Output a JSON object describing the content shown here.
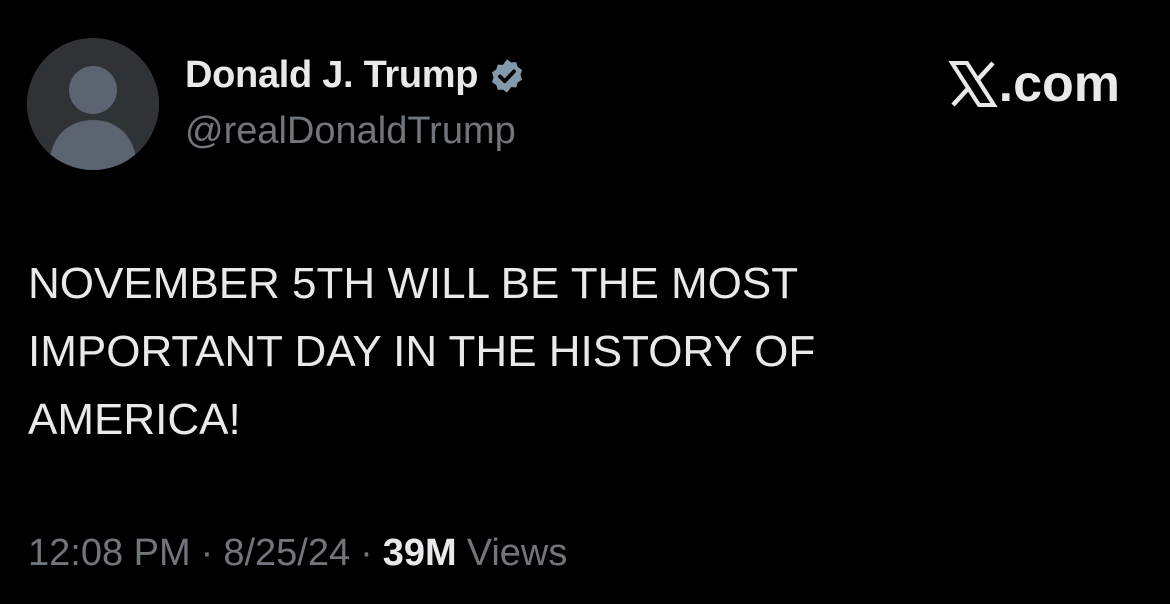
{
  "post": {
    "display_name": "Donald J. Trump",
    "handle": "@realDonaldTrump",
    "verified": true,
    "text": "NOVEMBER 5TH WILL BE THE MOST\nIMPORTANT DAY IN THE HISTORY OF\nAMERICA!",
    "time": "12:08 PM",
    "date": "8/25/24",
    "separator": "·",
    "views_count": "39M",
    "views_label": "Views"
  },
  "brand": {
    "suffix": ".com",
    "icon": "x-logo-icon"
  },
  "colors": {
    "background": "#000000",
    "primary_text": "#e7e9ea",
    "secondary_text": "#71767b",
    "verified_badge": "#829aab"
  }
}
